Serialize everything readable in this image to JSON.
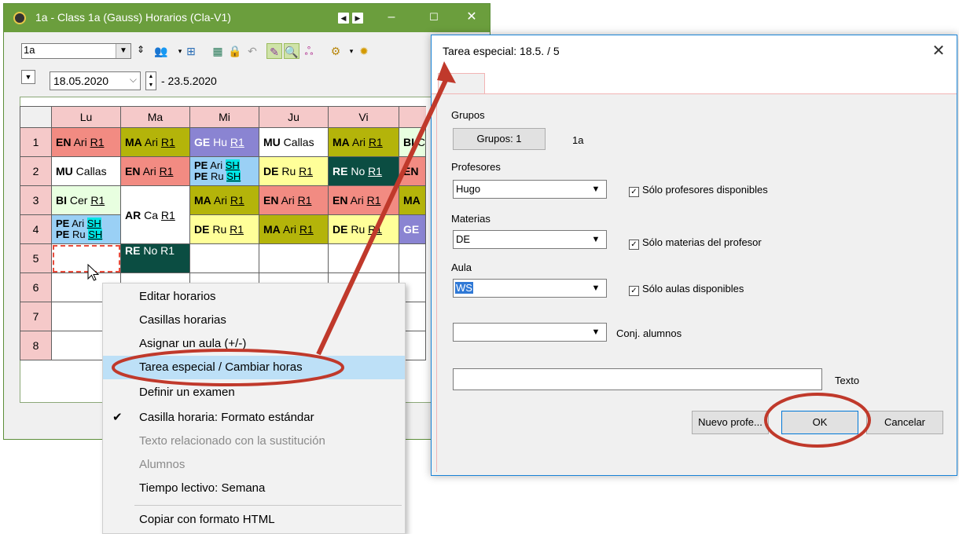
{
  "timetable_window": {
    "title": "1a - Class 1a (Gauss)  Horarios  (Cla-V1)",
    "class_selector": "1a",
    "date_from": "18.05.2020",
    "date_to": "- 23.5.2020",
    "days": [
      "Lu",
      "Ma",
      "Mi",
      "Ju",
      "Vi"
    ],
    "periods": [
      "1",
      "2",
      "3",
      "4",
      "5",
      "6",
      "7",
      "8"
    ],
    "cells": {
      "r1": [
        "EN Ari R1",
        "MA Ari R1",
        "GE Hu R1",
        "MU Callas",
        "MA Ari R1",
        "BI C"
      ],
      "r2": [
        "MU Callas",
        "EN Ari R1",
        "PE Ari SH / PE Ru SH",
        "DE Ru R1",
        "RE No R1",
        "EN"
      ],
      "r3": [
        "BI Cer R1",
        "AR Ca R1",
        "MA Ari R1",
        "EN Ari R1",
        "EN Ari R1",
        "MA"
      ],
      "r4": [
        "PE Ari SH / PE Ru SH",
        "",
        "DE Ru R1",
        "MA Ari R1",
        "DE Ru R1",
        "GE"
      ],
      "r5": [
        "",
        "RE No R1"
      ]
    },
    "colors": {
      "title_bar": "#6b9e3d",
      "EN": "#f28b82",
      "MA": "#b4b40a",
      "GE": "#8a84d2",
      "MU": "#ffffff",
      "PE": "#9ad0f5",
      "DE": "#ffff99",
      "RE": "#0b4d42",
      "BI": "#e8ffe0",
      "AR": "#ffffff",
      "header": "#f5c9c9"
    }
  },
  "context_menu": {
    "items": [
      {
        "label": "Editar horarios",
        "enabled": true
      },
      {
        "label": "Casillas horarias",
        "enabled": true
      },
      {
        "label": "Asignar un aula (+/-)",
        "enabled": true
      },
      {
        "label": "Tarea especial / Cambiar horas",
        "enabled": true,
        "highlighted": true
      },
      {
        "label": "Definir un examen",
        "enabled": true
      },
      {
        "label": "Casilla horaria: Formato estándar",
        "enabled": true,
        "checked": true
      },
      {
        "label": "Texto relacionado con la sustitución",
        "enabled": false
      },
      {
        "label": "Alumnos",
        "enabled": false
      },
      {
        "label": "Tiempo lectivo: Semana",
        "enabled": true
      },
      {
        "label": "Copiar con formato HTML",
        "enabled": true
      }
    ]
  },
  "dialog": {
    "title": "Tarea especial:  18.5. / 5",
    "grupos_label": "Grupos",
    "grupos_button": "Grupos: 1",
    "grupos_value": "1a",
    "profesores_label": "Profesores",
    "profesores_value": "Hugo",
    "profesores_check": "Sólo profesores disponibles",
    "materias_label": "Materias",
    "materias_value": "DE",
    "materias_check": "Sólo materias del profesor",
    "aula_label": "Aula",
    "aula_value": "WS",
    "aula_check": "Sólo aulas disponibles",
    "conj_label": "Conj. alumnos",
    "texto_label": "Texto",
    "nuevo_button": "Nuevo profe...",
    "ok_button": "OK",
    "cancel_button": "Cancelar",
    "accent": "#1883d7"
  },
  "annotations": {
    "highlight_color": "#c0392b"
  }
}
